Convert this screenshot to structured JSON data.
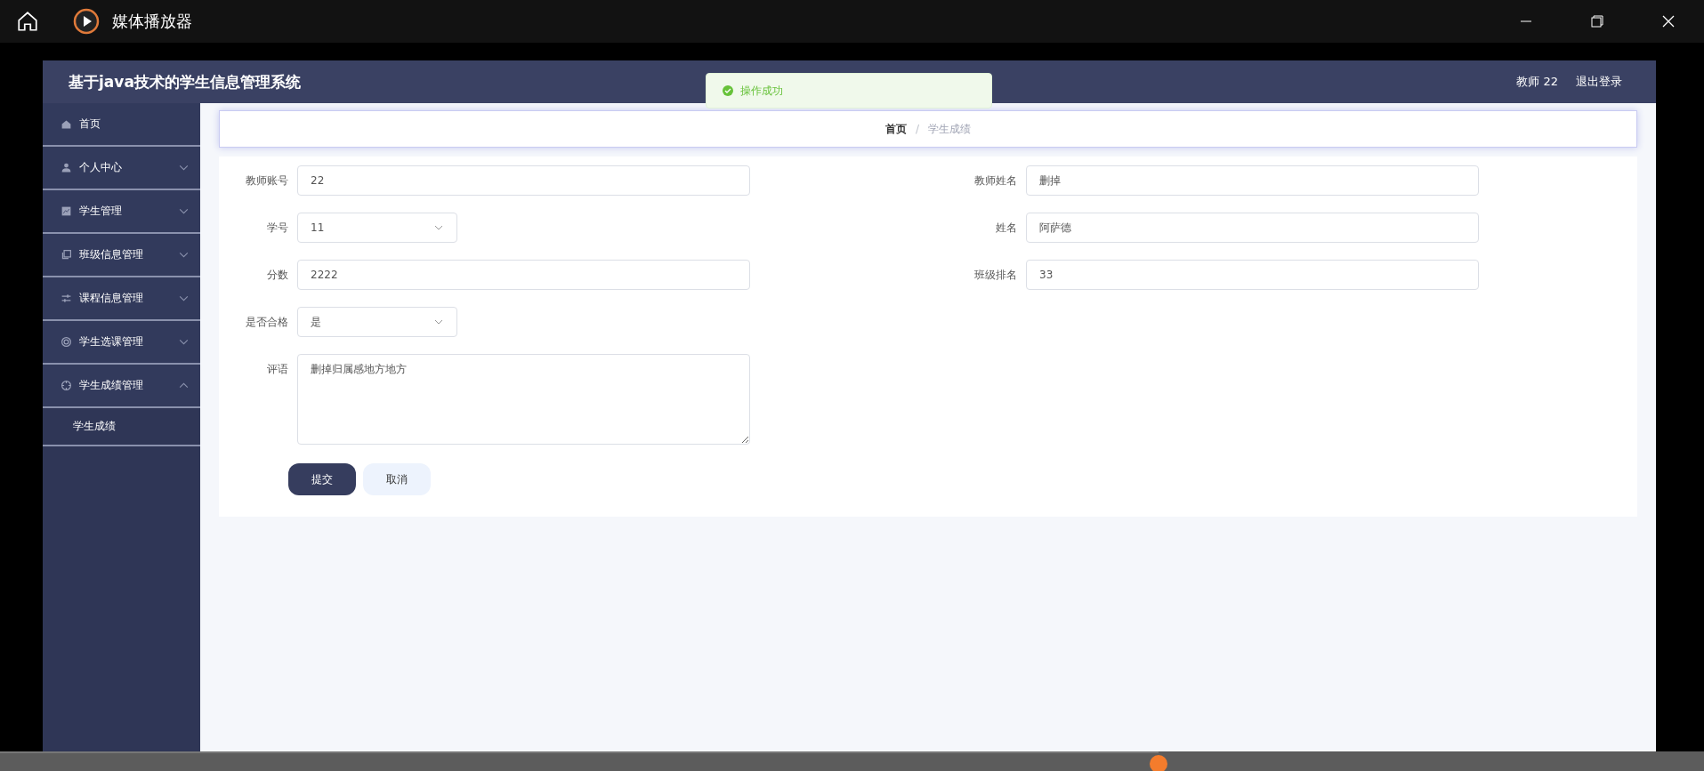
{
  "window": {
    "title": "媒体播放器"
  },
  "page": {
    "title": "基于java技术的学生信息管理系统",
    "user": "教师 22",
    "logout": "退出登录"
  },
  "toast": {
    "text": "操作成功"
  },
  "sidebar": {
    "items": [
      {
        "label": "首页",
        "kind": "link"
      },
      {
        "label": "个人中心",
        "kind": "menu",
        "expanded": false
      },
      {
        "label": "学生管理",
        "kind": "menu",
        "expanded": false
      },
      {
        "label": "班级信息管理",
        "kind": "menu",
        "expanded": false
      },
      {
        "label": "课程信息管理",
        "kind": "menu",
        "expanded": false
      },
      {
        "label": "学生选课管理",
        "kind": "menu",
        "expanded": false
      },
      {
        "label": "学生成绩管理",
        "kind": "menu",
        "expanded": true,
        "children": [
          {
            "label": "学生成绩"
          }
        ]
      }
    ]
  },
  "breadcrumb_separator": "/",
  "breadcrumb": [
    {
      "label": "首页",
      "current": false
    },
    {
      "label": "学生成绩",
      "current": true
    }
  ],
  "form": {
    "rows": [
      [
        {
          "label": "教师账号",
          "kind": "input",
          "value": "22"
        },
        {
          "label": "教师姓名",
          "kind": "input",
          "value": "删掉"
        }
      ],
      [
        {
          "label": "学号",
          "kind": "select",
          "value": "11"
        },
        {
          "label": "姓名",
          "kind": "input",
          "value": "阿萨德"
        }
      ],
      [
        {
          "label": "分数",
          "kind": "input",
          "value": "2222"
        },
        {
          "label": "班级排名",
          "kind": "input",
          "value": "33"
        }
      ],
      [
        {
          "label": "是否合格",
          "kind": "select",
          "value": "是"
        }
      ],
      [
        {
          "label": "评语",
          "kind": "textarea",
          "value": "删掉归属感地方地方"
        }
      ]
    ],
    "buttons": [
      {
        "label": "提交",
        "kind": "primary"
      },
      {
        "label": "取消",
        "kind": "secondary"
      }
    ]
  },
  "seek_bar": {
    "level": 0.68
  }
}
